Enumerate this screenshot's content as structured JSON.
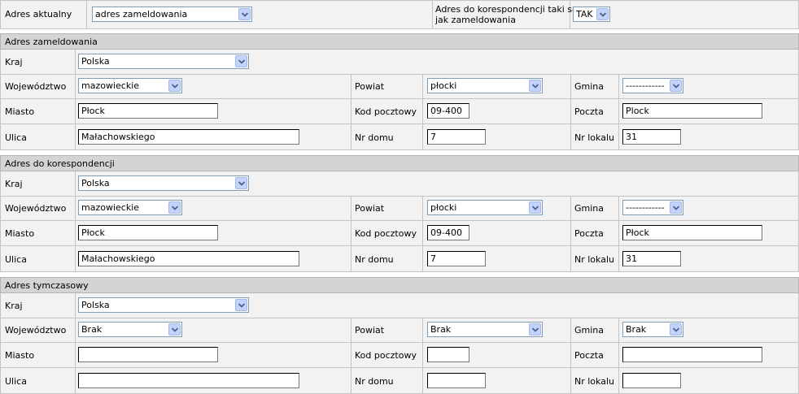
{
  "top": {
    "current_label": "Adres aktualny",
    "current_value": "adres zameldowania",
    "same_label_line1": "Adres do korespondencji taki sam",
    "same_label_line2": "jak zameldowania",
    "same_value": "TAK"
  },
  "sections": [
    {
      "title": "Adres zameldowania",
      "labels": {
        "country": "Kraj",
        "voivodeship": "Województwo",
        "county": "Powiat",
        "commune": "Gmina",
        "city": "Miasto",
        "postcode": "Kod pocztowy",
        "post": "Poczta",
        "street": "Ulica",
        "house": "Nr domu",
        "flat": "Nr lokalu"
      },
      "country": "Polska",
      "voivodeship": "mazowieckie",
      "county": "płocki",
      "commune": "------------",
      "city": "Płock",
      "postcode": "09-400",
      "post": "Plock",
      "street": "Małachowskiego",
      "house": "7",
      "flat": "31"
    },
    {
      "title": "Adres do korespondencji",
      "labels": {
        "country": "Kraj",
        "voivodeship": "Województwo",
        "county": "Powiat",
        "commune": "Gmina",
        "city": "Miasto",
        "postcode": "Kod pocztowy",
        "post": "Poczta",
        "street": "Ulica",
        "house": "Nr domu",
        "flat": "Nr lokalu"
      },
      "country": "Polska",
      "voivodeship": "mazowieckie",
      "county": "płocki",
      "commune": "------------",
      "city": "Płock",
      "postcode": "09-400",
      "post": "Płock",
      "street": "Małachowskiego",
      "house": "7",
      "flat": "31"
    },
    {
      "title": "Adres tymczasowy",
      "labels": {
        "country": "Kraj",
        "voivodeship": "Województwo",
        "county": "Powiat",
        "commune": "Gmina",
        "city": "Miasto",
        "postcode": "Kod pocztowy",
        "post": "Poczta",
        "street": "Ulica",
        "house": "Nr domu",
        "flat": "Nr lokalu"
      },
      "country": "Polska",
      "voivodeship": "Brak",
      "county": "Brak",
      "commune": "Brak",
      "city": "",
      "postcode": "",
      "post": "",
      "street": "",
      "house": "",
      "flat": ""
    }
  ]
}
